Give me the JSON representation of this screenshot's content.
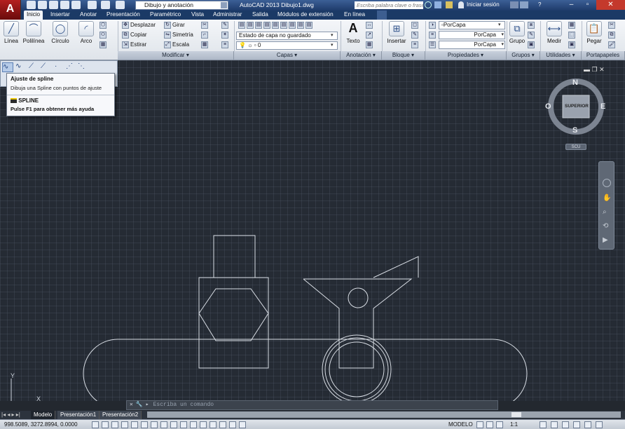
{
  "title_bar": {
    "app_icon": "autocad-logo-icon",
    "app_letter": "A",
    "workspace": "Dibujo y anotación",
    "window_title": "AutoCAD 2013    Dibujo1.dwg",
    "search_placeholder": "Escriba palabra clave o frase",
    "login": "Iniciar sesión",
    "help": "?"
  },
  "tabs": [
    "Inicio",
    "Insertar",
    "Anotar",
    "Presentación",
    "Paramétrico",
    "Vista",
    "Administrar",
    "Salida",
    "Módulos de extensión",
    "En línea"
  ],
  "ribbon": {
    "draw": {
      "linea": "Línea",
      "polilinea": "Polilínea",
      "circulo": "Círculo",
      "arco": "Arco"
    },
    "modify": {
      "title": "Modificar",
      "desplazar": "Desplazar",
      "girar": "Girar",
      "copiar": "Copiar",
      "simetria": "Simetría",
      "estirar": "Estirar",
      "escala": "Escala"
    },
    "layers": {
      "title": "Capas",
      "state": "Estado de capa no guardado",
      "current": "0"
    },
    "annotation": {
      "title": "Anotación",
      "texto": "Texto"
    },
    "block": {
      "title": "Bloque",
      "insertar": "Insertar"
    },
    "properties": {
      "title": "Propiedades",
      "color": "PorCapa",
      "linetype": "PorCapa",
      "lineweight": "PorCapa"
    },
    "groups": {
      "title": "Grupos",
      "grupo": "Grupo"
    },
    "utilities": {
      "title": "Utilidades",
      "medir": "Medir"
    },
    "clipboard": {
      "title": "Portapapeles",
      "pegar": "Pegar"
    }
  },
  "tooltip": {
    "title": "Ajuste de spline",
    "description": "Dibuja una Spline con puntos de ajuste",
    "command": "SPLINE",
    "help": "Pulse F1 para obtener más ayuda"
  },
  "viewcube": {
    "n": "N",
    "s": "S",
    "e": "E",
    "o": "O",
    "face": "SUPERIOR",
    "wcs": "SCU"
  },
  "ucs": {
    "x": "X",
    "y": "Y"
  },
  "command_line": {
    "placeholder": "Escriba un comando"
  },
  "layout_tabs": [
    "Modelo",
    "Presentación1",
    "Presentación2"
  ],
  "status": {
    "coords": "998.5089, 3272.8994, 0.0000",
    "space": "MODELO",
    "scale": "1:1"
  },
  "colors": {
    "canvas": "#252b34",
    "title_bar": "#1e3b6b",
    "geometry": "#d8dde4"
  }
}
